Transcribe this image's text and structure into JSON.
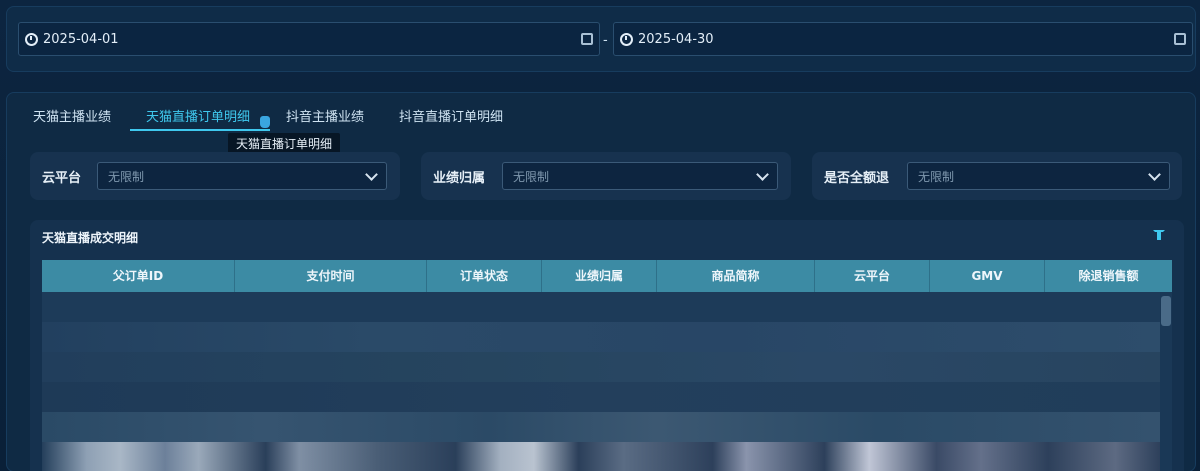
{
  "date_range": {
    "start": "2025-04-01",
    "end": "2025-04-30",
    "separator": "-"
  },
  "tabs": [
    {
      "label": "天猫主播业绩",
      "active": false
    },
    {
      "label": "天猫直播订单明细",
      "active": true
    },
    {
      "label": "抖音主播业绩",
      "active": false
    },
    {
      "label": "抖音直播订单明细",
      "active": false
    }
  ],
  "tooltip": "天猫直播订单明细",
  "filters": [
    {
      "label": "云平台",
      "value": "无限制"
    },
    {
      "label": "业绩归属",
      "value": "无限制"
    },
    {
      "label": "是否全额退",
      "value": "无限制"
    }
  ],
  "table": {
    "title": "天猫直播成交明细",
    "columns": [
      "父订单ID",
      "支付时间",
      "订单状态",
      "业绩归属",
      "商品简称",
      "云平台",
      "GMV",
      "除退销售额"
    ]
  },
  "colors": {
    "accent": "#3fc8ee",
    "header_bg": "#3c8ba4",
    "panel_bg": "#0f2a44"
  },
  "icons": [
    "clock-icon",
    "calendar-icon",
    "chevron-down-icon",
    "filter-icon",
    "pointer-cursor-icon"
  ]
}
